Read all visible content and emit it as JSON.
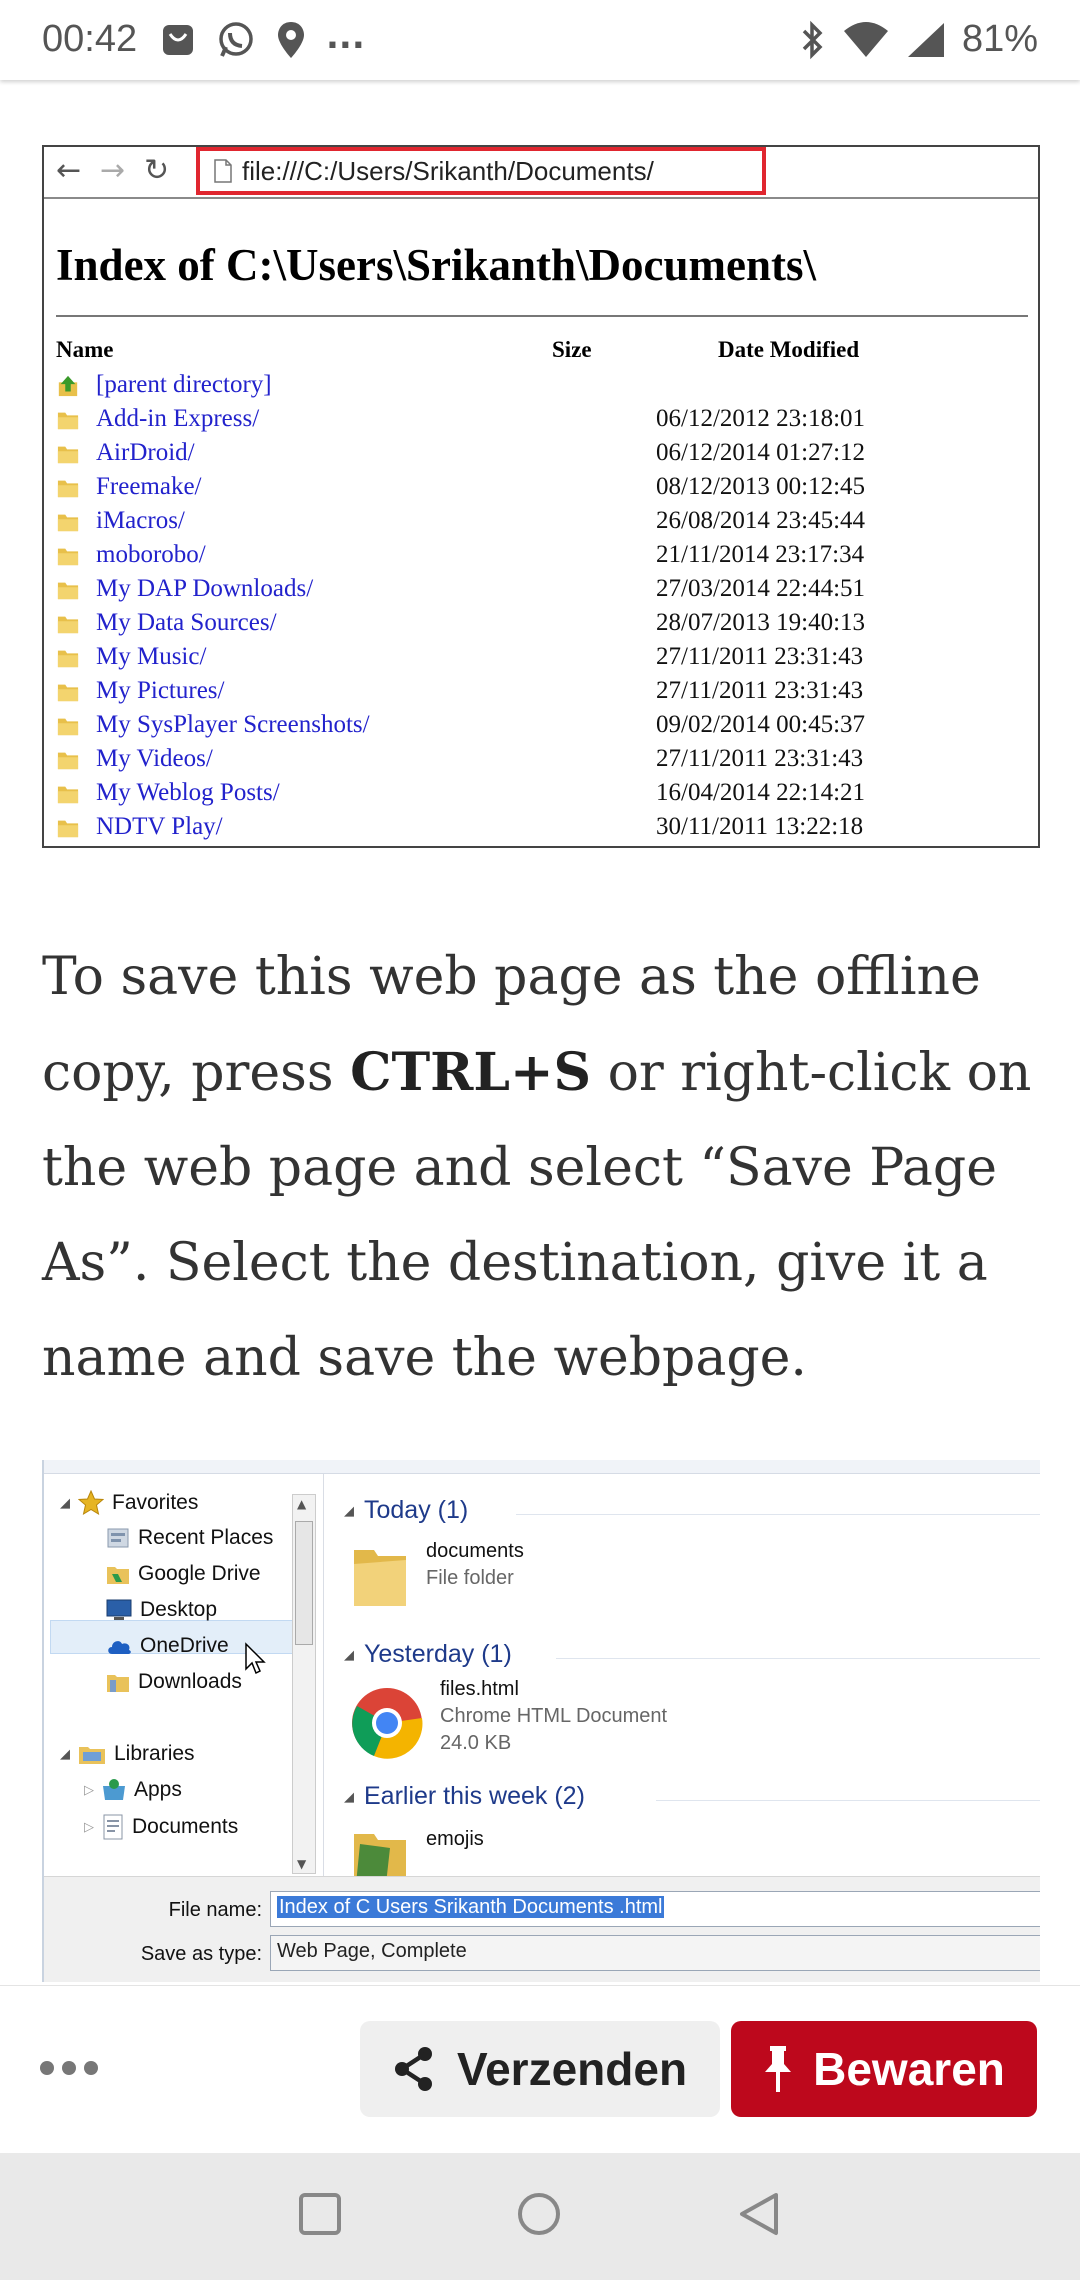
{
  "status_bar": {
    "time": "00:42",
    "battery_percent": "81%",
    "more_indicator": "...",
    "icons": [
      "app-notification-icon",
      "whatsapp-icon",
      "location-icon",
      "bluetooth-icon",
      "wifi-icon",
      "signal-icon"
    ]
  },
  "directory_screenshot": {
    "url": "file:///C:/Users/Srikanth/Documents/",
    "title": "Index of C:\\Users\\Srikanth\\Documents\\",
    "columns": {
      "name": "Name",
      "size": "Size",
      "date": "Date Modified"
    },
    "parent": "[parent directory]",
    "rows": [
      {
        "name": "Add-in Express/",
        "date": "06/12/2012 23:18:01"
      },
      {
        "name": "AirDroid/",
        "date": "06/12/2014 01:27:12"
      },
      {
        "name": "Freemake/",
        "date": "08/12/2013 00:12:45"
      },
      {
        "name": "iMacros/",
        "date": "26/08/2014 23:45:44"
      },
      {
        "name": "moborobo/",
        "date": "21/11/2014 23:17:34"
      },
      {
        "name": "My DAP Downloads/",
        "date": "27/03/2014 22:44:51"
      },
      {
        "name": "My Data Sources/",
        "date": "28/07/2013 19:40:13"
      },
      {
        "name": "My Music/",
        "date": "27/11/2011 23:31:43"
      },
      {
        "name": "My Pictures/",
        "date": "27/11/2011 23:31:43"
      },
      {
        "name": "My SysPlayer Screenshots/",
        "date": "09/02/2014 00:45:37"
      },
      {
        "name": "My Videos/",
        "date": "27/11/2011 23:31:43"
      },
      {
        "name": "My Weblog Posts/",
        "date": "16/04/2014 22:14:21"
      },
      {
        "name": "NDTV Play/",
        "date": "30/11/2011 13:22:18"
      }
    ]
  },
  "article": {
    "text_before": "To save this web page as the offline copy, press ",
    "bold": "CTRL+S",
    "text_after": " or right-click on the web page and select “Save Page As”. Select the destination, give it a name and save the webpage."
  },
  "save_dialog": {
    "nav": {
      "favorites": "Favorites",
      "recent_places": "Recent Places",
      "google_drive": "Google Drive",
      "desktop": "Desktop",
      "onedrive": "OneDrive",
      "downloads": "Downloads",
      "libraries": "Libraries",
      "apps": "Apps",
      "documents": "Documents"
    },
    "groups": {
      "today": "Today (1)",
      "yesterday": "Yesterday (1)",
      "earlier": "Earlier this week (2)"
    },
    "files": {
      "documents_name": "documents",
      "documents_type": "File folder",
      "html_name": "files.html",
      "html_type": "Chrome HTML Document",
      "html_size": "24.0 KB",
      "emojis_name": "emojis"
    },
    "file_name_label": "File name:",
    "file_name_value": "Index of C  Users Srikanth Documents .html",
    "save_type_label": "Save as type:",
    "save_type_value": "Web Page, Complete"
  },
  "actions": {
    "send_label": "Verzenden",
    "save_label": "Bewaren"
  },
  "colors": {
    "save_red": "#bd081c",
    "url_highlight": "#e0262f",
    "link_blue": "#2222cc"
  }
}
